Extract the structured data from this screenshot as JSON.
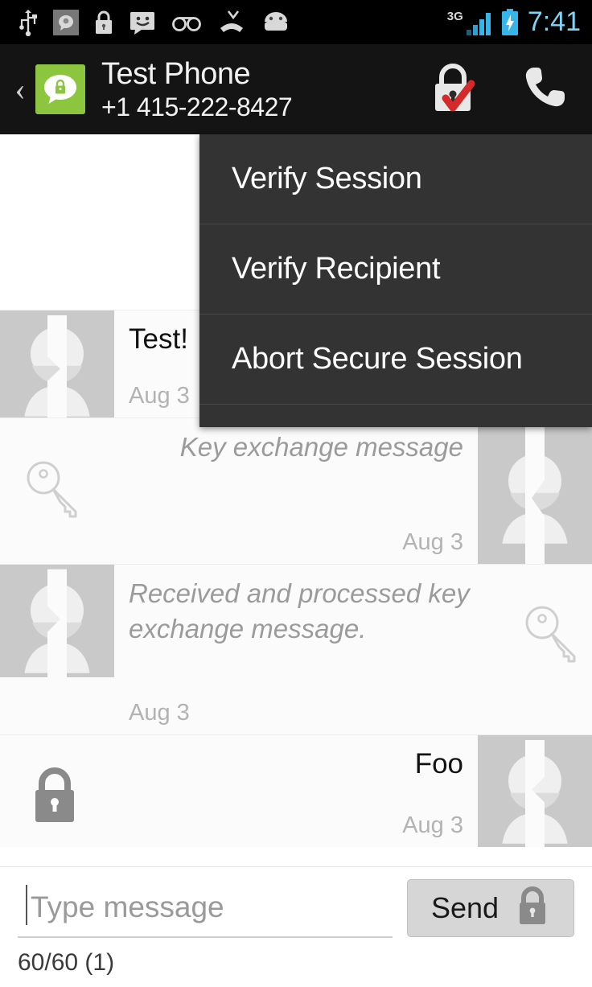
{
  "status_bar": {
    "icons": [
      "usb-icon",
      "app-notification-icon",
      "lock-icon",
      "sms-smiley-icon",
      "voicemail-icon",
      "missed-call-icon",
      "android-icon"
    ],
    "network_type": "3G",
    "signal": "signal-bars-icon",
    "battery": "battery-charging-icon",
    "time": "7:41",
    "clock_color": "#7fd4f5",
    "background": "#000000"
  },
  "action_bar": {
    "back_label": "‹",
    "app_icon": "textsecure-lock-bubble-icon",
    "app_icon_color": "#8cc63e",
    "contact_name": "Test Phone",
    "contact_number": "+1 415-222-8427",
    "security_icon": "lock-verified-icon",
    "call_icon": "phone-call-icon",
    "background": "#141414"
  },
  "options_menu": {
    "visible": true,
    "background": "#333333",
    "items": [
      {
        "label": "Verify Session",
        "name": "menu-item-verify-session"
      },
      {
        "label": "Verify Recipient",
        "name": "menu-item-verify-recipient"
      },
      {
        "label": "Abort Secure Session",
        "name": "menu-item-abort-secure-session"
      }
    ]
  },
  "conversation": {
    "messages": [
      {
        "id": 1,
        "direction": "incoming",
        "text": "Test!",
        "emphasis": false,
        "timestamp": "Aug 3",
        "status_icon": "none",
        "avatar": "default-person-avatar"
      },
      {
        "id": 2,
        "direction": "outgoing",
        "text": "Key exchange message",
        "emphasis": true,
        "timestamp": "Aug 3",
        "status_icon": "key-icon",
        "avatar": "default-person-avatar"
      },
      {
        "id": 3,
        "direction": "incoming",
        "text": "Received and processed key exchange message.",
        "emphasis": true,
        "timestamp": "Aug 3",
        "status_icon": "key-icon",
        "avatar": "default-person-avatar"
      },
      {
        "id": 4,
        "direction": "outgoing",
        "text": "Foo",
        "emphasis": false,
        "timestamp": "Aug 3",
        "status_icon": "lock-icon",
        "avatar": "default-person-avatar"
      }
    ]
  },
  "compose": {
    "input_value": "",
    "placeholder": "Type message",
    "send_label": "Send",
    "send_icon": "lock-icon",
    "char_counter": "60/60 (1)",
    "send_button_color": "#d6d6d6"
  }
}
